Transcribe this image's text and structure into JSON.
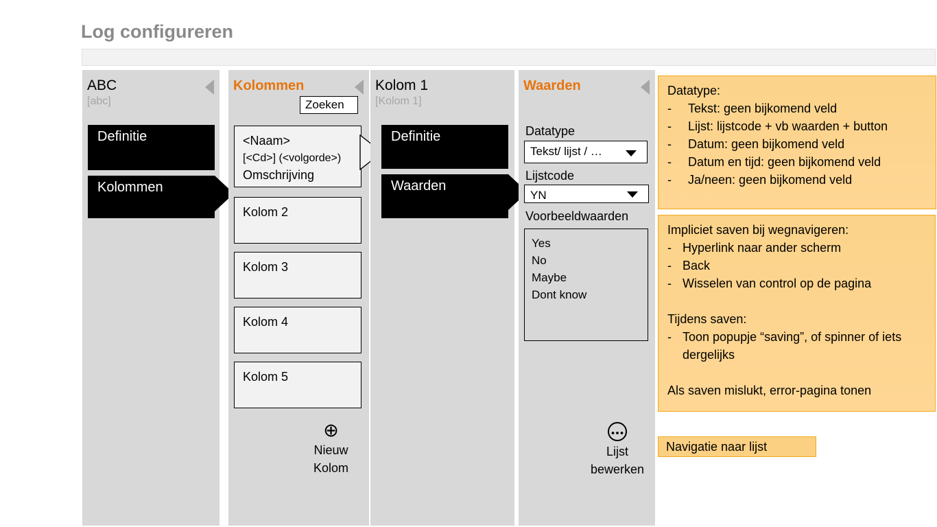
{
  "page": {
    "title": "Log configureren",
    "accent_color": "#e8740c",
    "note_color": "#fbd38a",
    "panel_color": "#d8d8d8"
  },
  "panels": {
    "abc": {
      "title": "ABC",
      "subtitle": "[abc]",
      "collapse_icon": "triangle-left-icon",
      "buttons": [
        {
          "label": "Definitie",
          "selected": false
        },
        {
          "label": "Kolommen",
          "selected": true
        }
      ]
    },
    "kolommen": {
      "title": "Kolommen",
      "collapse_icon": "triangle-left-icon",
      "search_label": "Zoeken",
      "cards": [
        {
          "line1": "<Naam>",
          "line2": "[<Cd>] (<volgorde>)",
          "line3": "Omschrijving"
        },
        {
          "line1": "Kolom 2"
        },
        {
          "line1": "Kolom 3"
        },
        {
          "line1": "Kolom 4"
        },
        {
          "line1": "Kolom 5"
        }
      ],
      "new_action": {
        "icon": "plus-circle-icon",
        "glyph": "⊕",
        "line1": "Nieuw",
        "line2": "Kolom"
      }
    },
    "kolom1": {
      "title": "Kolom 1",
      "subtitle": "[Kolom 1]",
      "buttons": [
        {
          "label": "Definitie",
          "selected": false
        },
        {
          "label": "Waarden",
          "selected": true
        }
      ]
    },
    "waarden": {
      "title": "Waarden",
      "collapse_icon": "triangle-left-icon",
      "datatype_label": "Datatype",
      "datatype_value": "Tekst/ lijst / …",
      "lijstcode_label": "Lijstcode",
      "lijstcode_value": "YN",
      "voorbeeldwaarden_label": "Voorbeeldwaarden",
      "voorbeeldwaarden": [
        "Yes",
        "No",
        "Maybe",
        "Dont know"
      ],
      "edit_action": {
        "icon": "ellipsis-circle-icon",
        "glyph": "Ⓒ",
        "line1": "Lijst",
        "line2": "bewerken"
      }
    }
  },
  "notes": {
    "datatype": {
      "heading": "Datatype:",
      "items": [
        "Tekst: geen bijkomend veld",
        "Lijst: lijstcode + vb waarden + button",
        "Datum: geen bijkomend veld",
        "Datum en tijd: geen bijkomend veld",
        "Ja/neen: geen bijkomend veld"
      ],
      "dash": "-"
    },
    "saving": {
      "heading1": "Impliciet saven bij wegnavigeren:",
      "items1": [
        "Hyperlink naar ander scherm",
        "Back",
        "Wisselen van control op de pagina"
      ],
      "heading2": "Tijdens saven:",
      "items2": [
        "Toon popupje “saving”, of spinner of iets dergelijks"
      ],
      "footer": "Als saven mislukt, error-pagina tonen",
      "dash": "-"
    }
  },
  "navigatie_button": {
    "label": "Navigatie naar lijst"
  }
}
